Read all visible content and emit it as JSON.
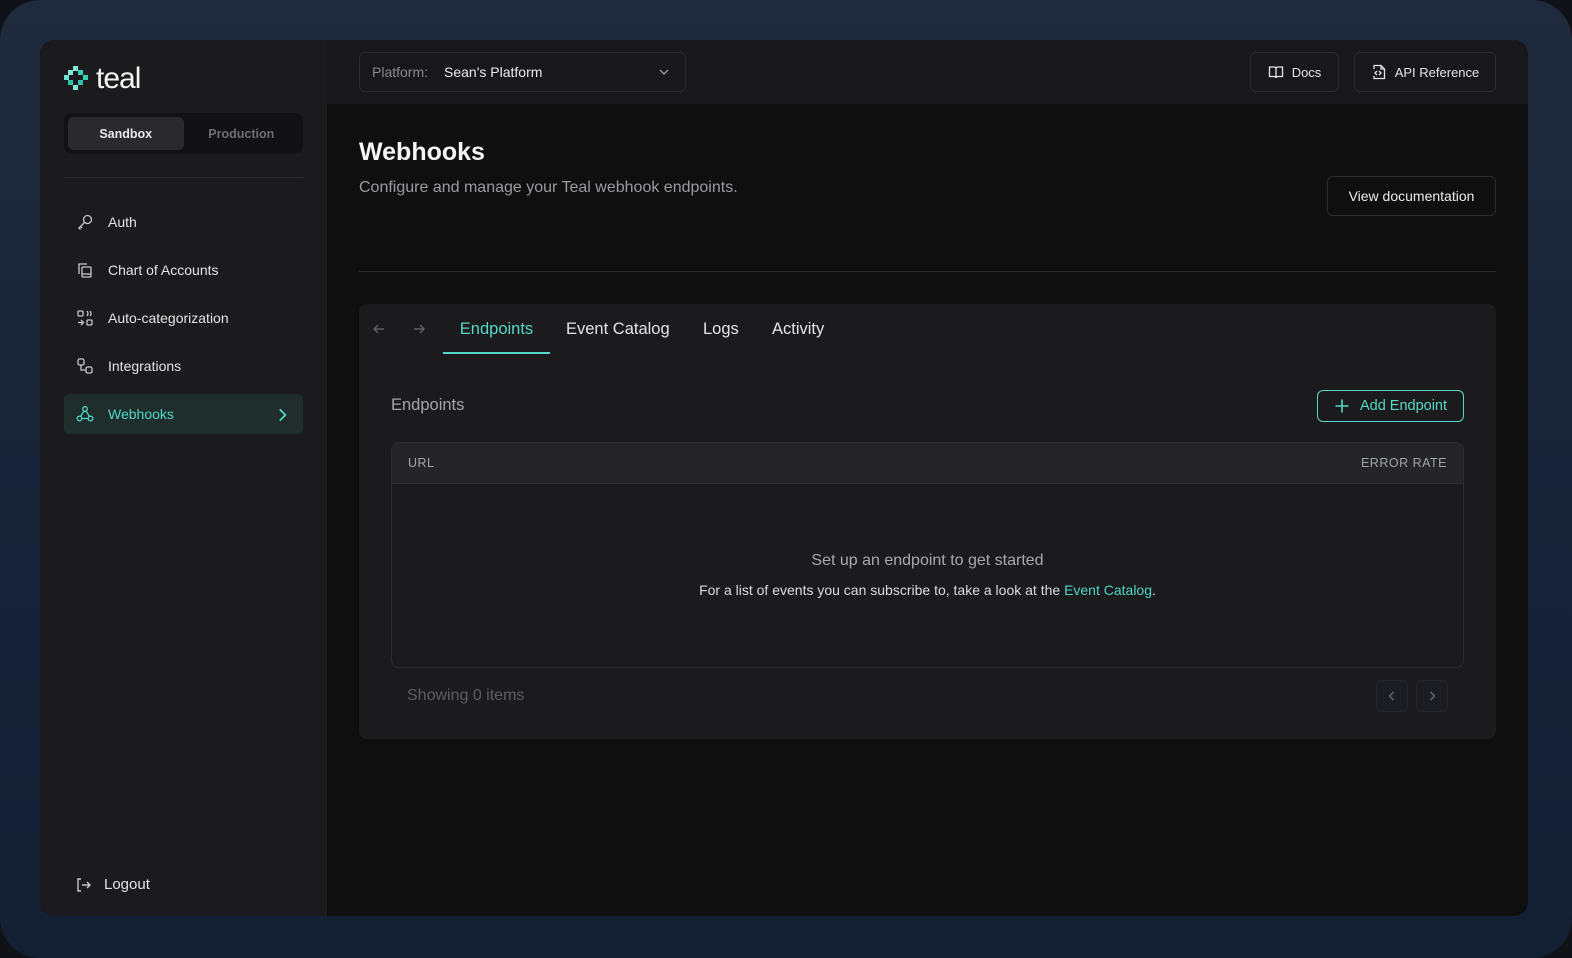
{
  "brand": {
    "name": "teal",
    "accent": "#56d8c6"
  },
  "environment": {
    "options": [
      "Sandbox",
      "Production"
    ],
    "selected": "Sandbox"
  },
  "sidebar": {
    "items": [
      {
        "label": "Auth",
        "icon": "key-icon"
      },
      {
        "label": "Chart of Accounts",
        "icon": "copy-icon"
      },
      {
        "label": "Auto-categorization",
        "icon": "auto-categorize-icon"
      },
      {
        "label": "Integrations",
        "icon": "integrations-icon"
      },
      {
        "label": "Webhooks",
        "icon": "webhook-icon",
        "active": true
      }
    ],
    "logout_label": "Logout"
  },
  "topbar": {
    "platform_label": "Platform:",
    "platform_value": "Sean's Platform",
    "docs_label": "Docs",
    "api_label": "API Reference"
  },
  "page": {
    "title": "Webhooks",
    "subtitle": "Configure and manage your Teal webhook endpoints.",
    "view_doc_label": "View documentation"
  },
  "tabs": [
    {
      "label": "Endpoints",
      "active": true
    },
    {
      "label": "Event Catalog"
    },
    {
      "label": "Logs"
    },
    {
      "label": "Activity"
    }
  ],
  "endpoints": {
    "section_title": "Endpoints",
    "add_label": "Add Endpoint",
    "columns": [
      "URL",
      "ERROR RATE"
    ],
    "rows": [],
    "empty_title": "Set up an endpoint to get started",
    "empty_desc": "For a list of events you can subscribe to, take a look at the ",
    "empty_link": "Event Catalog",
    "empty_suffix": ".",
    "showing": "Showing 0 items"
  }
}
